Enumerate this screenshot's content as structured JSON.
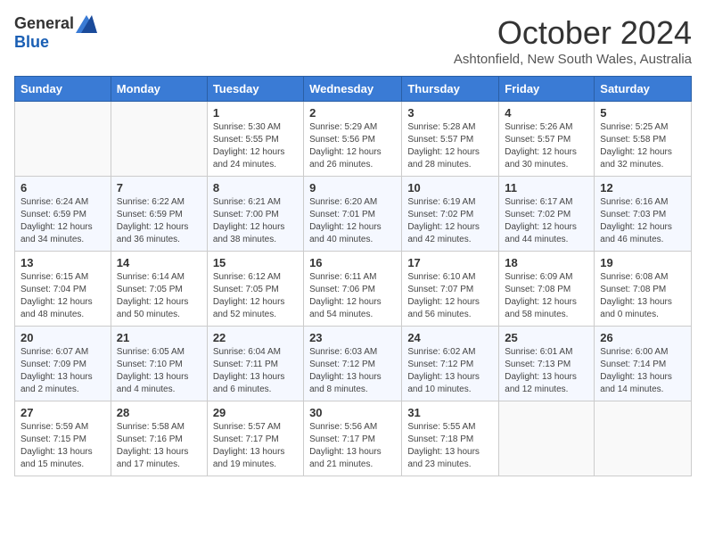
{
  "logo": {
    "general": "General",
    "blue": "Blue"
  },
  "title": "October 2024",
  "subtitle": "Ashtonfield, New South Wales, Australia",
  "days_of_week": [
    "Sunday",
    "Monday",
    "Tuesday",
    "Wednesday",
    "Thursday",
    "Friday",
    "Saturday"
  ],
  "weeks": [
    [
      {
        "day": "",
        "info": ""
      },
      {
        "day": "",
        "info": ""
      },
      {
        "day": "1",
        "info": "Sunrise: 5:30 AM\nSunset: 5:55 PM\nDaylight: 12 hours\nand 24 minutes."
      },
      {
        "day": "2",
        "info": "Sunrise: 5:29 AM\nSunset: 5:56 PM\nDaylight: 12 hours\nand 26 minutes."
      },
      {
        "day": "3",
        "info": "Sunrise: 5:28 AM\nSunset: 5:57 PM\nDaylight: 12 hours\nand 28 minutes."
      },
      {
        "day": "4",
        "info": "Sunrise: 5:26 AM\nSunset: 5:57 PM\nDaylight: 12 hours\nand 30 minutes."
      },
      {
        "day": "5",
        "info": "Sunrise: 5:25 AM\nSunset: 5:58 PM\nDaylight: 12 hours\nand 32 minutes."
      }
    ],
    [
      {
        "day": "6",
        "info": "Sunrise: 6:24 AM\nSunset: 6:59 PM\nDaylight: 12 hours\nand 34 minutes."
      },
      {
        "day": "7",
        "info": "Sunrise: 6:22 AM\nSunset: 6:59 PM\nDaylight: 12 hours\nand 36 minutes."
      },
      {
        "day": "8",
        "info": "Sunrise: 6:21 AM\nSunset: 7:00 PM\nDaylight: 12 hours\nand 38 minutes."
      },
      {
        "day": "9",
        "info": "Sunrise: 6:20 AM\nSunset: 7:01 PM\nDaylight: 12 hours\nand 40 minutes."
      },
      {
        "day": "10",
        "info": "Sunrise: 6:19 AM\nSunset: 7:02 PM\nDaylight: 12 hours\nand 42 minutes."
      },
      {
        "day": "11",
        "info": "Sunrise: 6:17 AM\nSunset: 7:02 PM\nDaylight: 12 hours\nand 44 minutes."
      },
      {
        "day": "12",
        "info": "Sunrise: 6:16 AM\nSunset: 7:03 PM\nDaylight: 12 hours\nand 46 minutes."
      }
    ],
    [
      {
        "day": "13",
        "info": "Sunrise: 6:15 AM\nSunset: 7:04 PM\nDaylight: 12 hours\nand 48 minutes."
      },
      {
        "day": "14",
        "info": "Sunrise: 6:14 AM\nSunset: 7:05 PM\nDaylight: 12 hours\nand 50 minutes."
      },
      {
        "day": "15",
        "info": "Sunrise: 6:12 AM\nSunset: 7:05 PM\nDaylight: 12 hours\nand 52 minutes."
      },
      {
        "day": "16",
        "info": "Sunrise: 6:11 AM\nSunset: 7:06 PM\nDaylight: 12 hours\nand 54 minutes."
      },
      {
        "day": "17",
        "info": "Sunrise: 6:10 AM\nSunset: 7:07 PM\nDaylight: 12 hours\nand 56 minutes."
      },
      {
        "day": "18",
        "info": "Sunrise: 6:09 AM\nSunset: 7:08 PM\nDaylight: 12 hours\nand 58 minutes."
      },
      {
        "day": "19",
        "info": "Sunrise: 6:08 AM\nSunset: 7:08 PM\nDaylight: 13 hours\nand 0 minutes."
      }
    ],
    [
      {
        "day": "20",
        "info": "Sunrise: 6:07 AM\nSunset: 7:09 PM\nDaylight: 13 hours\nand 2 minutes."
      },
      {
        "day": "21",
        "info": "Sunrise: 6:05 AM\nSunset: 7:10 PM\nDaylight: 13 hours\nand 4 minutes."
      },
      {
        "day": "22",
        "info": "Sunrise: 6:04 AM\nSunset: 7:11 PM\nDaylight: 13 hours\nand 6 minutes."
      },
      {
        "day": "23",
        "info": "Sunrise: 6:03 AM\nSunset: 7:12 PM\nDaylight: 13 hours\nand 8 minutes."
      },
      {
        "day": "24",
        "info": "Sunrise: 6:02 AM\nSunset: 7:12 PM\nDaylight: 13 hours\nand 10 minutes."
      },
      {
        "day": "25",
        "info": "Sunrise: 6:01 AM\nSunset: 7:13 PM\nDaylight: 13 hours\nand 12 minutes."
      },
      {
        "day": "26",
        "info": "Sunrise: 6:00 AM\nSunset: 7:14 PM\nDaylight: 13 hours\nand 14 minutes."
      }
    ],
    [
      {
        "day": "27",
        "info": "Sunrise: 5:59 AM\nSunset: 7:15 PM\nDaylight: 13 hours\nand 15 minutes."
      },
      {
        "day": "28",
        "info": "Sunrise: 5:58 AM\nSunset: 7:16 PM\nDaylight: 13 hours\nand 17 minutes."
      },
      {
        "day": "29",
        "info": "Sunrise: 5:57 AM\nSunset: 7:17 PM\nDaylight: 13 hours\nand 19 minutes."
      },
      {
        "day": "30",
        "info": "Sunrise: 5:56 AM\nSunset: 7:17 PM\nDaylight: 13 hours\nand 21 minutes."
      },
      {
        "day": "31",
        "info": "Sunrise: 5:55 AM\nSunset: 7:18 PM\nDaylight: 13 hours\nand 23 minutes."
      },
      {
        "day": "",
        "info": ""
      },
      {
        "day": "",
        "info": ""
      }
    ]
  ]
}
